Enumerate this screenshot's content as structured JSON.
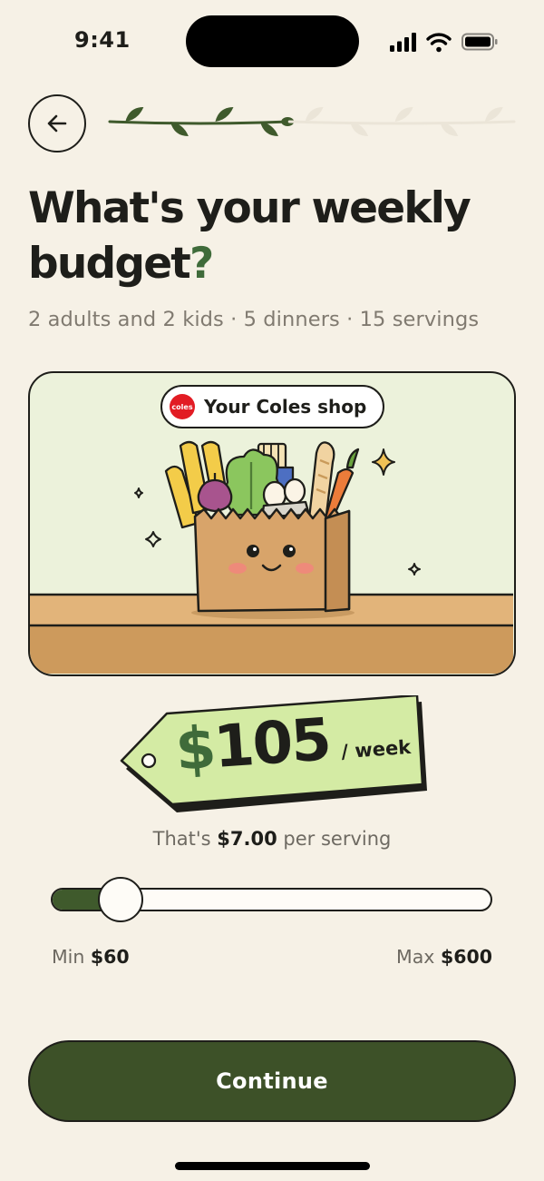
{
  "status_bar": {
    "time": "9:41"
  },
  "progress": {
    "completed_steps": 4,
    "total_steps": 9
  },
  "header": {
    "title_main": "What's your weekly budget",
    "title_mark": "?",
    "subtitle": "2 adults and 2 kids · 5 dinners · 15 servings"
  },
  "illustration": {
    "store_label": "Your Coles shop",
    "logo_text": "coles"
  },
  "price": {
    "currency": "$",
    "amount": "105",
    "unit": "/ week"
  },
  "serving": {
    "prefix": "That's ",
    "amount": "$7.00",
    "suffix": " per serving"
  },
  "slider": {
    "min_label": "Min ",
    "min_value": "$60",
    "max_label": "Max ",
    "max_value": "$600",
    "current_value": 105
  },
  "actions": {
    "continue_label": "Continue"
  },
  "colors": {
    "background": "#f6f1e6",
    "accent_green": "#3d5128",
    "tag_green": "#d4eba4",
    "card_green": "#ecf2db",
    "coles_red": "#e21c24"
  }
}
